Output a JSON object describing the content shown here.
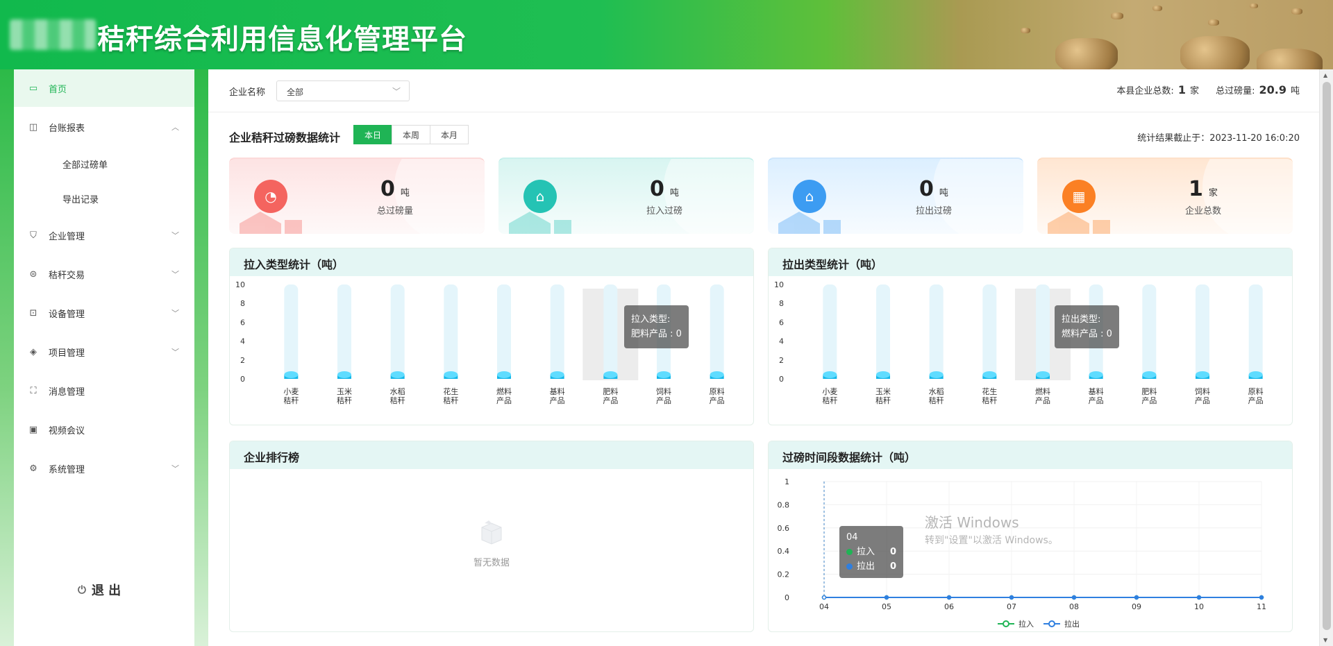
{
  "header": {
    "title": "秸秆综合利用信息化管理平台"
  },
  "sidebar": {
    "items": [
      {
        "label": "首页",
        "icon": "monitor-icon",
        "glyph": "▭",
        "active": true
      },
      {
        "label": "台账报表",
        "icon": "ledger-icon",
        "glyph": "◫",
        "expanded": true,
        "children": [
          {
            "label": "全部过磅单"
          },
          {
            "label": "导出记录"
          }
        ]
      },
      {
        "label": "企业管理",
        "icon": "shield-icon",
        "glyph": "⛉"
      },
      {
        "label": "秸秆交易",
        "icon": "coin-icon",
        "glyph": "⊜"
      },
      {
        "label": "设备管理",
        "icon": "device-icon",
        "glyph": "⊡"
      },
      {
        "label": "项目管理",
        "icon": "layers-icon",
        "glyph": "◈"
      },
      {
        "label": "消息管理",
        "icon": "message-icon",
        "glyph": "⛶"
      },
      {
        "label": "视频会议",
        "icon": "video-icon",
        "glyph": "▣"
      },
      {
        "label": "系统管理",
        "icon": "gear-icon",
        "glyph": "⚙"
      }
    ],
    "logout_label": "退 出"
  },
  "filter": {
    "label": "企业名称",
    "value": "全部",
    "county_total_label": "本县企业总数:",
    "county_total_value": "1",
    "county_total_unit": "家",
    "weigh_total_label": "总过磅量:",
    "weigh_total_value": "20.9",
    "weigh_total_unit": "吨"
  },
  "stats": {
    "title": "企业秸秆过磅数据统计",
    "tabs": [
      "本日",
      "本周",
      "本月"
    ],
    "active_tab": 0,
    "timestamp": "统计结果截止于：2023-11-20 16:0:20",
    "cards": [
      {
        "value": "0",
        "unit": "吨",
        "caption": "总过磅量",
        "color": "#f4645f",
        "bg": "#fde3e3",
        "icon": "pie-chart-icon",
        "glyph": "◔"
      },
      {
        "value": "0",
        "unit": "吨",
        "caption": "拉入过磅",
        "color": "#25c3b4",
        "bg": "#d8f5f1",
        "icon": "warehouse-in-icon",
        "glyph": "⌂"
      },
      {
        "value": "0",
        "unit": "吨",
        "caption": "拉出过磅",
        "color": "#3c9cf2",
        "bg": "#dcefff",
        "icon": "warehouse-out-icon",
        "glyph": "⌂"
      },
      {
        "value": "1",
        "unit": "家",
        "caption": "企业总数",
        "color": "#fb8024",
        "bg": "#ffe6d2",
        "icon": "building-icon",
        "glyph": "▦"
      }
    ]
  },
  "panels": {
    "in_title": "拉入类型统计（吨）",
    "out_title": "拉出类型统计（吨）",
    "rank_title": "企业排行榜",
    "rank_empty": "暂无数据",
    "time_title": "过磅时间段数据统计（吨）"
  },
  "tooltips": {
    "in_l1": "拉入类型:",
    "in_l2": "肥料产品 : 0",
    "out_l1": "拉出类型:",
    "out_l2": "燃料产品 : 0",
    "time_head": "04",
    "time_in_label": "拉入",
    "time_in_value": "0",
    "time_out_label": "拉出",
    "time_out_value": "0"
  },
  "watermark": {
    "line1": "激活 Windows",
    "line2": "转到\"设置\"以激活 Windows。"
  },
  "chart_data": [
    {
      "type": "bar",
      "title": "拉入类型统计（吨）",
      "categories": [
        "小麦秸秆",
        "玉米秸秆",
        "水稻秸秆",
        "花生秸秆",
        "燃料产品",
        "基料产品",
        "肥料产品",
        "饲料产品",
        "原料产品"
      ],
      "category_lines": [
        [
          "小麦",
          "秸秆"
        ],
        [
          "玉米",
          "秸秆"
        ],
        [
          "水稻",
          "秸秆"
        ],
        [
          "花生",
          "秸秆"
        ],
        [
          "燃料",
          "产品"
        ],
        [
          "基料",
          "产品"
        ],
        [
          "肥料",
          "产品"
        ],
        [
          "饲料",
          "产品"
        ],
        [
          "原料",
          "产品"
        ]
      ],
      "values": [
        0,
        0,
        0,
        0,
        0,
        0,
        0,
        0,
        0
      ],
      "ylim": [
        0,
        10
      ],
      "yticks": [
        0,
        2,
        4,
        6,
        8,
        10
      ],
      "highlight_index": 6
    },
    {
      "type": "bar",
      "title": "拉出类型统计（吨）",
      "categories": [
        "小麦秸秆",
        "玉米秸秆",
        "水稻秸秆",
        "花生秸秆",
        "燃料产品",
        "基料产品",
        "肥料产品",
        "饲料产品",
        "原料产品"
      ],
      "category_lines": [
        [
          "小麦",
          "秸秆"
        ],
        [
          "玉米",
          "秸秆"
        ],
        [
          "水稻",
          "秸秆"
        ],
        [
          "花生",
          "秸秆"
        ],
        [
          "燃料",
          "产品"
        ],
        [
          "基料",
          "产品"
        ],
        [
          "肥料",
          "产品"
        ],
        [
          "饲料",
          "产品"
        ],
        [
          "原料",
          "产品"
        ]
      ],
      "values": [
        0,
        0,
        0,
        0,
        0,
        0,
        0,
        0,
        0
      ],
      "ylim": [
        0,
        10
      ],
      "yticks": [
        0,
        2,
        4,
        6,
        8,
        10
      ],
      "highlight_index": 4
    },
    {
      "type": "line",
      "title": "过磅时间段数据统计（吨）",
      "x": [
        "04",
        "05",
        "06",
        "07",
        "08",
        "09",
        "10",
        "11"
      ],
      "series": [
        {
          "name": "拉入",
          "values": [
            0,
            0,
            0,
            0,
            0,
            0,
            0,
            0
          ],
          "color": "#1fb455"
        },
        {
          "name": "拉出",
          "values": [
            0,
            0,
            0,
            0,
            0,
            0,
            0,
            0
          ],
          "color": "#2f7fe0"
        }
      ],
      "ylim": [
        0,
        1
      ],
      "yticks": [
        "0",
        "0.2",
        "0.4",
        "0.6",
        "0.8",
        "1"
      ],
      "legend": "bottom-center"
    }
  ]
}
